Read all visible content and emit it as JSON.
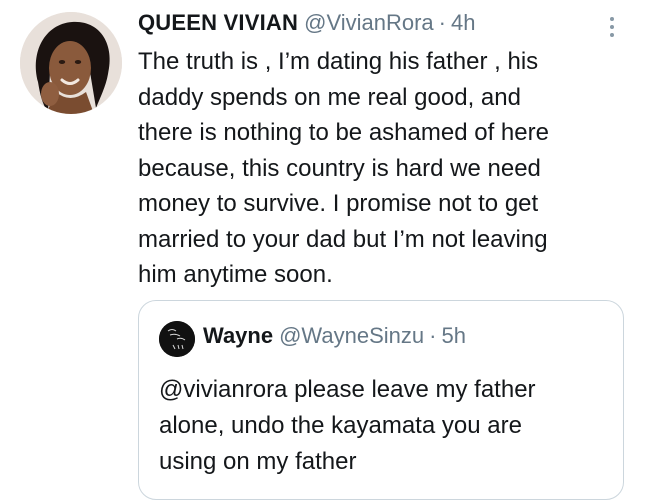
{
  "tweet": {
    "display_name": "QUEEN VIVIAN",
    "handle": "@VivianRora",
    "separator": "·",
    "time": "4h",
    "text": "The truth is , I’m dating his father , his\ndaddy spends on me real good, and\nthere is nothing to be ashamed of here\nbecause, this country is hard we need\nmoney to survive.  I promise not to get\nmarried to your dad but I’m not leaving\nhim anytime soon.",
    "avatar_icon": "profile-photo",
    "more_icon": "vertical-ellipsis-icon"
  },
  "quoted_tweet": {
    "display_name": "Wayne",
    "handle": "@WayneSinzu",
    "separator": "·",
    "time": "5h",
    "text": "@vivianrora please leave my father\nalone, undo the kayamata you are\nusing on my father",
    "avatar_icon": "profile-photo"
  },
  "colors": {
    "text_primary": "#14171a",
    "text_secondary": "#657786",
    "border": "#ccd6dd",
    "background": "#ffffff"
  }
}
